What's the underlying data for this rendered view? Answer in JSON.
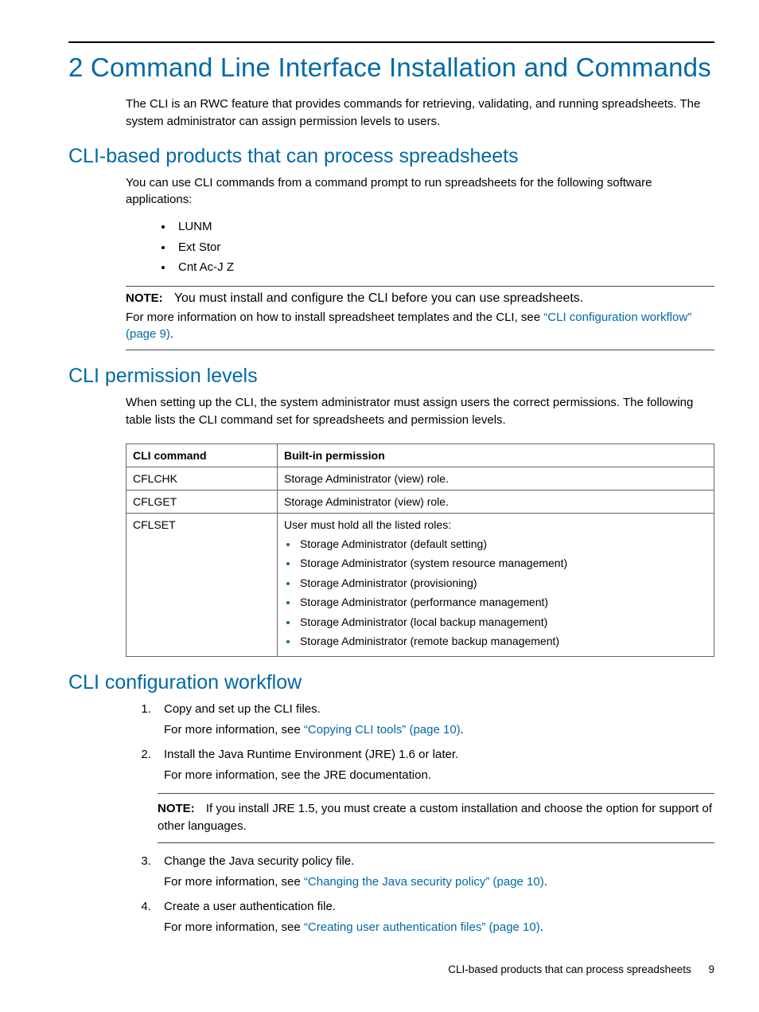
{
  "chapter_title": "2 Command Line Interface Installation and Commands",
  "intro": "The CLI is an RWC feature that provides commands for retrieving, validating, and running spreadsheets. The system administrator can assign permission levels to users.",
  "section1": {
    "heading": "CLI-based products that can process spreadsheets",
    "lead": "You can use CLI commands from a command prompt to run spreadsheets for the following software applications:",
    "items": [
      "LUNM",
      "Ext Stor",
      "Cnt Ac-J Z"
    ],
    "note_label": "NOTE:",
    "note_line1": "You must install and configure the CLI before you can use spreadsheets.",
    "note_line2_pre": "For more information on how to install spreadsheet templates and the CLI, see ",
    "note_link": "“CLI configuration workflow” (page 9)",
    "note_line2_post": "."
  },
  "section2": {
    "heading": "CLI permission levels",
    "lead": "When setting up the CLI, the system administrator must assign users the correct permissions. The following table lists the CLI command set for spreadsheets and permission levels.",
    "table": {
      "head": [
        "CLI command",
        "Built-in permission"
      ],
      "rows": [
        {
          "cmd": "CFLCHK",
          "perm_text": "Storage Administrator (view) role."
        },
        {
          "cmd": "CFLGET",
          "perm_text": "Storage Administrator (view) role."
        },
        {
          "cmd": "CFLSET",
          "perm_lead": "User must hold all the listed roles:",
          "perm_items": [
            "Storage Administrator (default setting)",
            "Storage Administrator (system resource management)",
            "Storage Administrator (provisioning)",
            "Storage Administrator (performance management)",
            "Storage Administrator (local backup management)",
            "Storage Administrator (remote backup management)"
          ]
        }
      ]
    }
  },
  "section3": {
    "heading": "CLI configuration workflow",
    "steps": [
      {
        "line1": "Copy and set up the CLI files.",
        "line2_pre": "For more information, see ",
        "link": "“Copying CLI tools” (page 10)",
        "line2_post": "."
      },
      {
        "line1": "Install the Java Runtime Environment (JRE) 1.6 or later.",
        "line2": "For more information, see the JRE documentation.",
        "note_label": "NOTE:",
        "note_text": "If you install JRE 1.5, you must create a custom installation and choose the option for support of other languages."
      },
      {
        "line1": "Change the Java security policy file.",
        "line2_pre": "For more information, see ",
        "link": "“Changing the Java security policy” (page 10)",
        "line2_post": "."
      },
      {
        "line1": "Create a user authentication file.",
        "line2_pre": "For more information, see ",
        "link": "“Creating user authentication files” (page 10)",
        "line2_post": "."
      }
    ]
  },
  "footer_text": "CLI-based products that can process spreadsheets",
  "page_number": "9"
}
